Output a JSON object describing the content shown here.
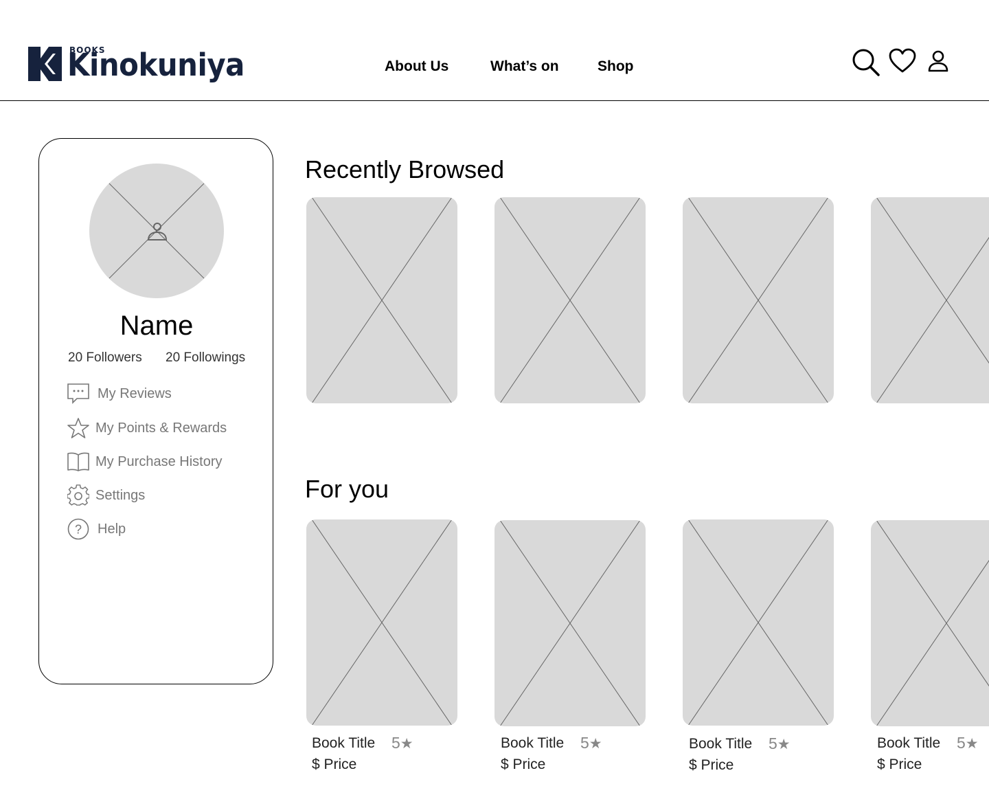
{
  "brand": {
    "small": "BOOKS",
    "name": "Kinokuniya",
    "color": "#16223d"
  },
  "nav": {
    "items": [
      "About Us",
      "What’s on",
      "Shop"
    ]
  },
  "header_icons": [
    "search-icon",
    "heart-icon",
    "user-icon"
  ],
  "profile": {
    "name": "Name",
    "followers": "20 Followers",
    "followings": "20 Followings",
    "menu": [
      {
        "label": "My Reviews",
        "icon": "chat-icon"
      },
      {
        "label": "My Points & Rewards",
        "icon": "star-icon"
      },
      {
        "label": "My Purchase History",
        "icon": "book-icon"
      },
      {
        "label": "Settings",
        "icon": "gear-icon"
      },
      {
        "label": "Help",
        "icon": "help-icon"
      }
    ]
  },
  "recently_browsed": {
    "title": "Recently Browsed"
  },
  "for_you": {
    "title": "For you",
    "books": [
      {
        "title": "Book Title",
        "rating": "5",
        "price": "$ Price"
      },
      {
        "title": "Book Title",
        "rating": "5",
        "price": "$ Price"
      },
      {
        "title": "Book Title",
        "rating": "5",
        "price": "$ Price"
      },
      {
        "title": "Book Title",
        "rating": "5",
        "price": "$ Price"
      }
    ]
  },
  "colors": {
    "placeholder": "#d9d9d9",
    "muted_text": "#777777"
  }
}
